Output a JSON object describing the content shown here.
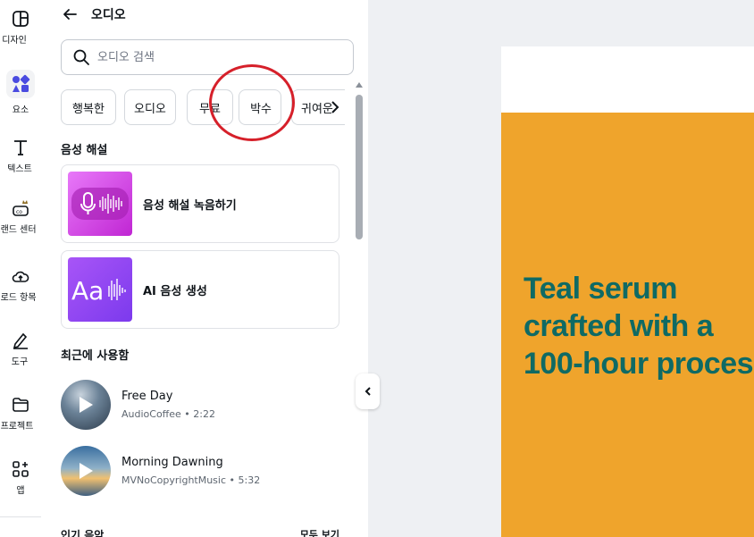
{
  "rail": {
    "items": [
      {
        "label": "디자인",
        "icon": "design-layout-icon"
      },
      {
        "label": "요소",
        "icon": "elements-shapes-icon",
        "active": true
      },
      {
        "label": "텍스트",
        "icon": "text-t-icon"
      },
      {
        "label": "브랜드 센터",
        "icon": "brand-center-icon"
      },
      {
        "label": "업로드 항목",
        "icon": "upload-cloud-icon"
      },
      {
        "label": "도구",
        "icon": "draw-tool-icon"
      },
      {
        "label": "프로젝트",
        "icon": "folder-icon"
      },
      {
        "label": "앱",
        "icon": "apps-grid-icon"
      }
    ]
  },
  "panel": {
    "title": "오디오",
    "search_placeholder": "오디오 검색",
    "chips": [
      "행복한",
      "오디오",
      "무료",
      "박수",
      "귀여운"
    ],
    "voice_section_title": "음성 해설",
    "voice_cards": [
      {
        "label": "음성 해설 녹음하기",
        "icon": "microphone-waveform-icon"
      },
      {
        "label": "AI 음성 생성",
        "icon": "ai-voice-text-icon"
      }
    ],
    "recent_title": "최근에 사용함",
    "tracks": [
      {
        "title": "Free Day",
        "meta": "AudioCoffee • 2:22"
      },
      {
        "title": "Morning Dawning",
        "meta": "MVNoCopyrightMusic • 5:32"
      }
    ],
    "popular_title": "인기 음악",
    "see_all": "모두 보기"
  },
  "canvas": {
    "headline": "Teal serum\ncrafted with a\n100-hour proces",
    "colors": {
      "orange": "#efa42c",
      "teal": "#0f6a64"
    }
  },
  "annotation": {
    "highlight_color": "#d6202a"
  }
}
